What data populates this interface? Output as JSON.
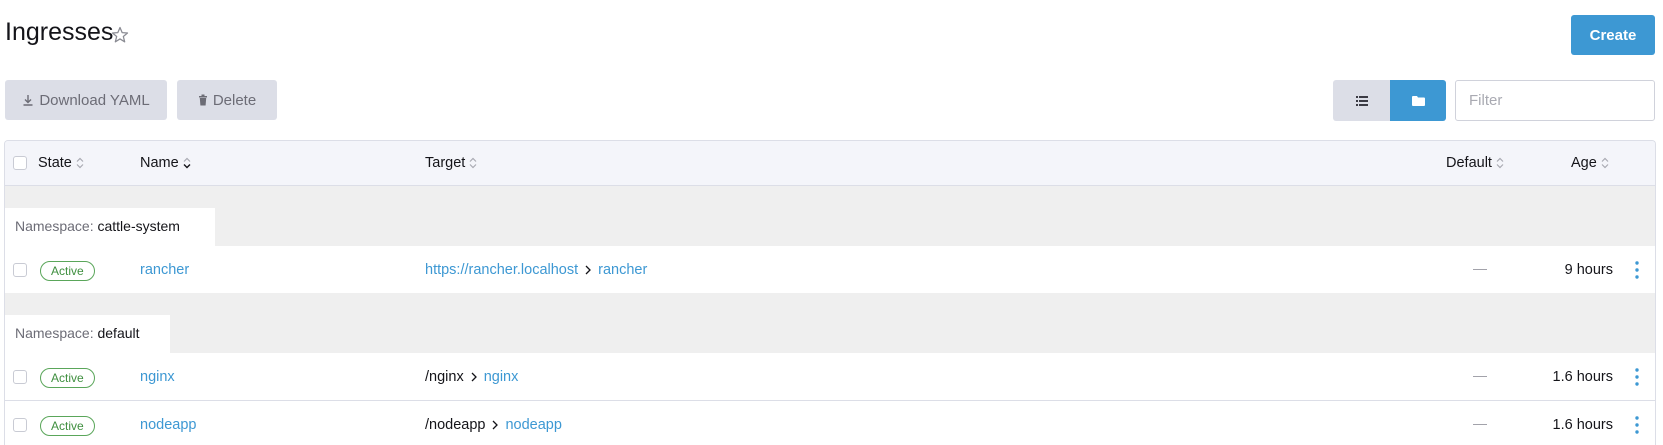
{
  "page": {
    "title": "Ingresses",
    "create_label": "Create"
  },
  "toolbar": {
    "download_label": "Download YAML",
    "delete_label": "Delete",
    "filter_placeholder": "Filter"
  },
  "table": {
    "columns": [
      "State",
      "Name",
      "Target",
      "Default",
      "Age"
    ],
    "groups": [
      {
        "label": "Namespace:",
        "namespace": "cattle-system",
        "rows": [
          {
            "state": "Active",
            "name": "rancher",
            "target_host": "https://rancher.localhost",
            "target_service": "rancher",
            "default": "—",
            "age": "9 hours"
          }
        ]
      },
      {
        "label": "Namespace:",
        "namespace": "default",
        "rows": [
          {
            "state": "Active",
            "name": "nginx",
            "target_host": "/nginx",
            "target_service": "nginx",
            "default": "—",
            "age": "1.6 hours"
          },
          {
            "state": "Active",
            "name": "nodeapp",
            "target_host": "/nodeapp",
            "target_service": "nodeapp",
            "default": "—",
            "age": "1.6 hours"
          }
        ]
      }
    ]
  },
  "colors": {
    "accent": "#3d98d3",
    "active_badge": "#5aa65a",
    "button_grey": "#dcdee7"
  },
  "icons": [
    "star-icon",
    "download-icon",
    "trash-icon",
    "list-icon",
    "folder-icon",
    "sort-icon",
    "chevron-right-icon",
    "kebab-icon"
  ]
}
